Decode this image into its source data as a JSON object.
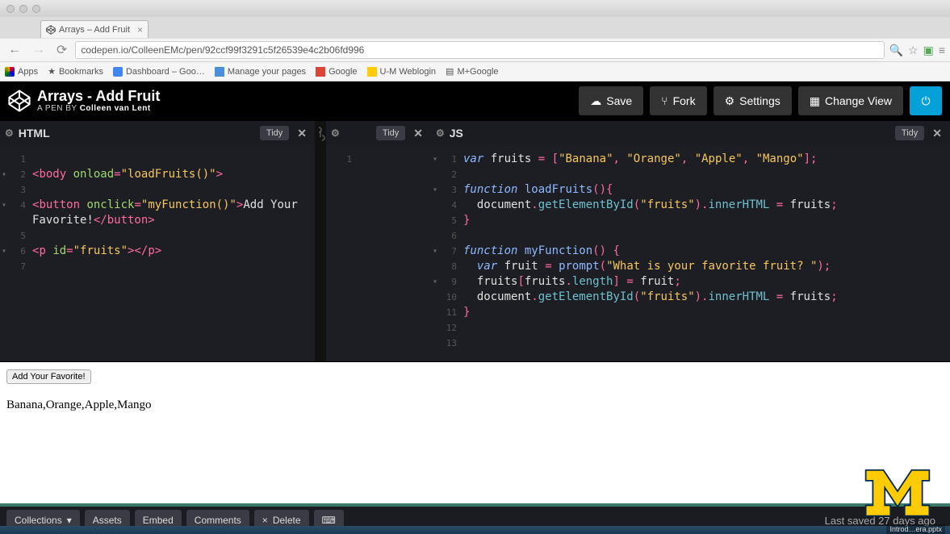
{
  "browser": {
    "tab_title": "Arrays – Add Fruit",
    "url": "codepen.io/ColleenEMc/pen/92ccf99f3291c5f26539e4c2b06fd996",
    "bookmarks": [
      "Apps",
      "Bookmarks",
      "Dashboard – Goo…",
      "Manage your pages",
      "Google",
      "U-M Weblogin",
      "M+Google"
    ]
  },
  "codepen": {
    "title": "Arrays - Add Fruit",
    "byline_prefix": "A PEN BY",
    "author": "Colleen van Lent",
    "actions": {
      "save": "Save",
      "fork": "Fork",
      "settings": "Settings",
      "change_view": "Change View"
    },
    "panes": {
      "html": {
        "title": "HTML",
        "tidy": "Tidy"
      },
      "css": {
        "title": "",
        "tidy": "Tidy"
      },
      "js": {
        "title": "JS",
        "tidy": "Tidy"
      }
    },
    "html_code_lines": [
      "",
      "<body onload=\"loadFruits()\">",
      "",
      "<button onclick=\"myFunction()\">Add Your",
      "Favorite!</button>",
      "",
      "<p id=\"fruits\"></p>",
      ""
    ],
    "js_code_lines": [
      "var fruits = [\"Banana\", \"Orange\", \"Apple\", \"Mango\"];",
      "",
      "function loadFruits(){",
      "  document.getElementById(\"fruits\").innerHTML = fruits;",
      "}",
      "",
      "function myFunction() {",
      "  var fruit = prompt(\"What is your favorite fruit? \");",
      "  fruits[fruits.length] = fruit;",
      "  document.getElementById(\"fruits\").innerHTML = fruits;",
      "}",
      "",
      ""
    ],
    "output": {
      "button_label": "Add Your Favorite!",
      "fruits_text": "Banana,Orange,Apple,Mango"
    },
    "footer": {
      "collections": "Collections",
      "assets": "Assets",
      "embed": "Embed",
      "comments": "Comments",
      "delete": "Delete",
      "saved": "Last saved 27 days ago"
    }
  },
  "taskbar_file": "Introd…era.pptx"
}
